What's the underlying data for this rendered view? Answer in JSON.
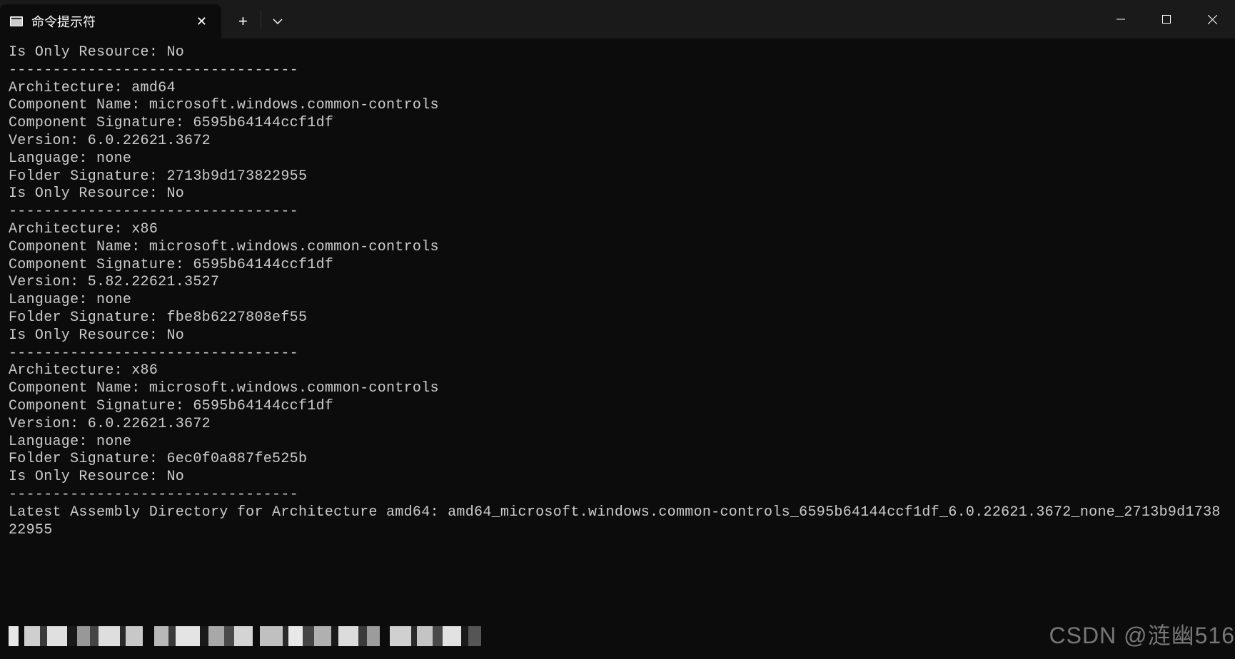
{
  "tab": {
    "title": "命令提示符"
  },
  "separator": "---------------------------------",
  "labels": {
    "is_only_resource": "Is Only Resource: ",
    "architecture": "Architecture: ",
    "component_name": "Component Name: ",
    "component_signature": "Component Signature: ",
    "version": "Version: ",
    "language": "Language: ",
    "folder_signature": "Folder Signature: ",
    "latest_assembly": "Latest Assembly Directory for Architecture amd64: "
  },
  "entries": [
    {
      "is_only_resource": "No",
      "architecture": "amd64",
      "component_name": "microsoft.windows.common-controls",
      "component_signature": "6595b64144ccf1df",
      "version": "6.0.22621.3672",
      "language": "none",
      "folder_signature": "2713b9d173822955"
    },
    {
      "is_only_resource": "No",
      "architecture": "x86",
      "component_name": "microsoft.windows.common-controls",
      "component_signature": "6595b64144ccf1df",
      "version": "5.82.22621.3527",
      "language": "none",
      "folder_signature": "fbe8b6227808ef55"
    },
    {
      "is_only_resource": "No",
      "architecture": "x86",
      "component_name": "microsoft.windows.common-controls",
      "component_signature": "6595b64144ccf1df",
      "version": "6.0.22621.3672",
      "language": "none",
      "folder_signature": "6ec0f0a887fe525b"
    },
    {
      "is_only_resource": "No"
    }
  ],
  "latest_assembly_value": "amd64_microsoft.windows.common-controls_6595b64144ccf1df_6.0.22621.3672_none_2713b9d173822955",
  "watermark": "CSDN @涟幽516"
}
